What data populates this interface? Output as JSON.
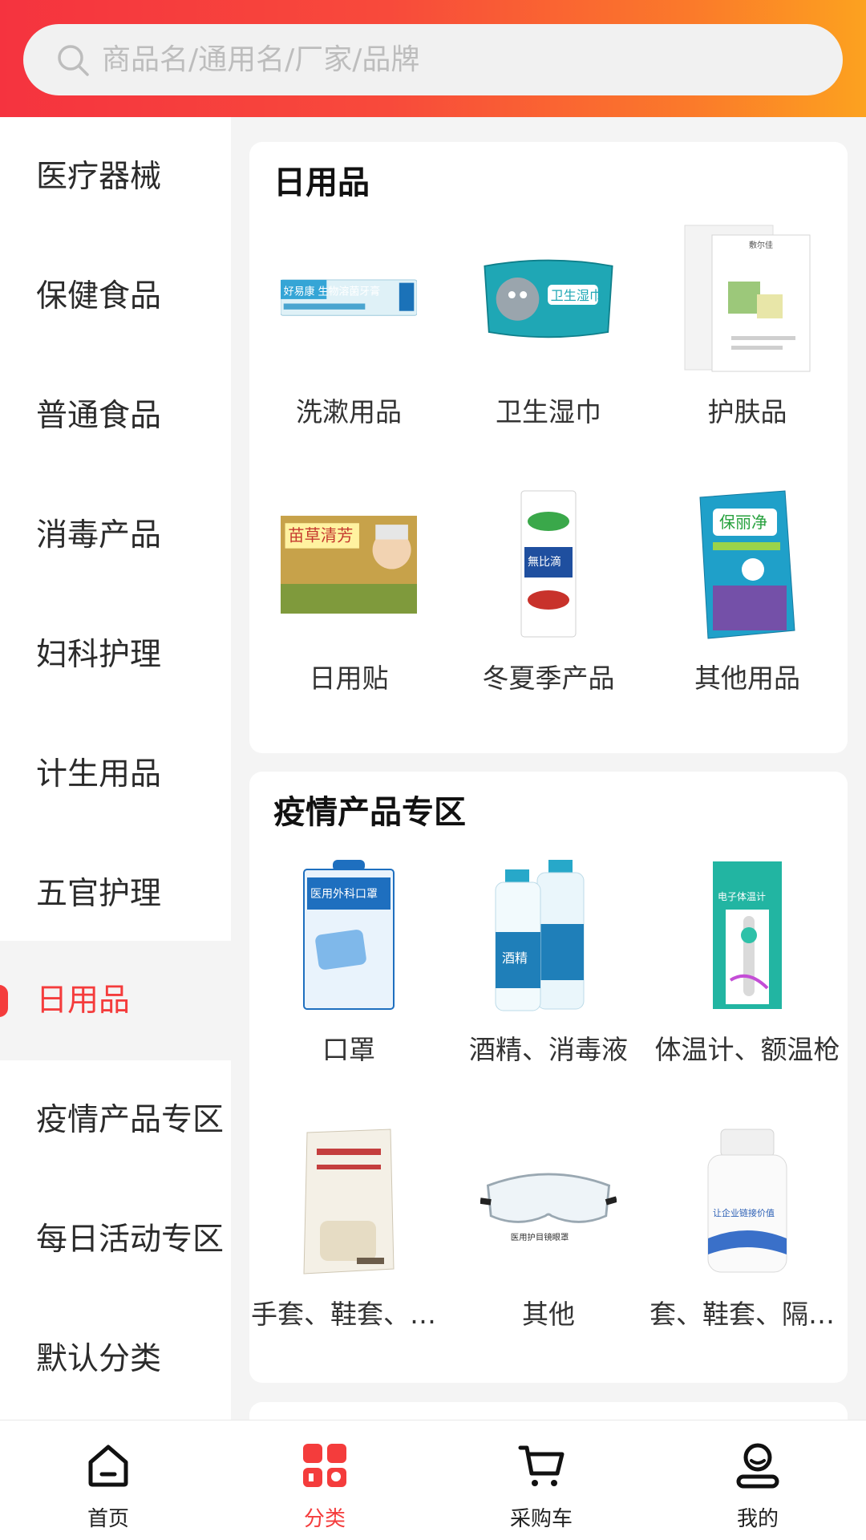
{
  "search": {
    "placeholder": "商品名/通用名/厂家/品牌"
  },
  "sidebar": {
    "items": [
      {
        "label": "医疗器械"
      },
      {
        "label": "保健食品"
      },
      {
        "label": "普通食品"
      },
      {
        "label": "消毒产品"
      },
      {
        "label": "妇科护理"
      },
      {
        "label": "计生用品"
      },
      {
        "label": "五官护理"
      },
      {
        "label": "日用品"
      },
      {
        "label": "疫情产品专区"
      },
      {
        "label": "每日活动专区"
      },
      {
        "label": "默认分类"
      }
    ],
    "active_index": 7
  },
  "sections": [
    {
      "title": "日用品",
      "items": [
        {
          "label": "洗漱用品",
          "icon": "toothpaste-box",
          "product_text": "好易康 生物溶菌牙膏"
        },
        {
          "label": "卫生湿巾",
          "icon": "wet-wipes-pack",
          "product_text": "卫生湿巾"
        },
        {
          "label": "护肤品",
          "icon": "face-mask-pack",
          "product_text": "敷尔佳"
        },
        {
          "label": "日用贴",
          "icon": "patch-box",
          "product_text": "苗草清芳"
        },
        {
          "label": "冬夏季产品",
          "icon": "liquid-bottle",
          "product_text": "無比滴"
        },
        {
          "label": "其他用品",
          "icon": "cleaning-tablets-box",
          "product_text": "保丽净"
        }
      ]
    },
    {
      "title": "疫情产品专区",
      "items": [
        {
          "label": "口罩",
          "icon": "mask-box",
          "product_text": "医用外科口罩"
        },
        {
          "label": "酒精、消毒液",
          "icon": "alcohol-bottles",
          "product_text": "酒精"
        },
        {
          "label": "体温计、额温枪",
          "icon": "thermometer-box",
          "product_text": "电子体温计"
        },
        {
          "label": "手套、鞋套、隔...",
          "icon": "gloves-bag",
          "product_text": ""
        },
        {
          "label": "其他",
          "icon": "goggles",
          "product_text": "医用护目镜眼罩"
        },
        {
          "label": "套、鞋套、隔离...",
          "icon": "white-bottle",
          "product_text": "让企业链接价值"
        }
      ]
    }
  ],
  "tabbar": {
    "tabs": [
      {
        "label": "首页",
        "icon": "home-icon"
      },
      {
        "label": "分类",
        "icon": "category-icon"
      },
      {
        "label": "采购车",
        "icon": "cart-icon"
      },
      {
        "label": "我的",
        "icon": "profile-icon"
      }
    ],
    "active_index": 1
  },
  "colors": {
    "accent": "#f43c3c",
    "header_start": "#f5333f",
    "header_end": "#fca21f"
  }
}
